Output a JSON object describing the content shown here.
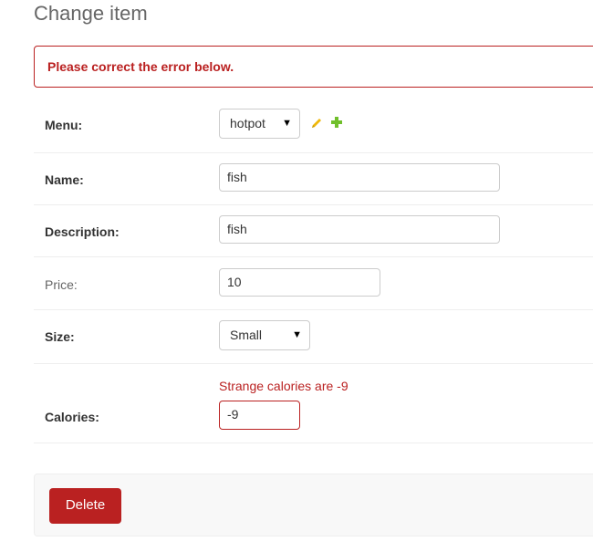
{
  "page": {
    "title": "Change item"
  },
  "errornote": {
    "text": "Please correct the error below."
  },
  "form": {
    "menu": {
      "label": "Menu:",
      "selected": "hotpot",
      "edit_icon": "pencil-icon",
      "add_icon": "plus-icon"
    },
    "name": {
      "label": "Name:",
      "value": "fish"
    },
    "description": {
      "label": "Description:",
      "value": "fish"
    },
    "price": {
      "label": "Price:",
      "value": "10"
    },
    "size": {
      "label": "Size:",
      "selected": "Small"
    },
    "calories": {
      "label": "Calories:",
      "error": "Strange calories are -9",
      "value": "-9"
    }
  },
  "submit": {
    "delete_label": "Delete"
  },
  "colors": {
    "error": "#ba2121",
    "edit_icon": "#efb80b",
    "add_icon": "#70bf2b"
  }
}
